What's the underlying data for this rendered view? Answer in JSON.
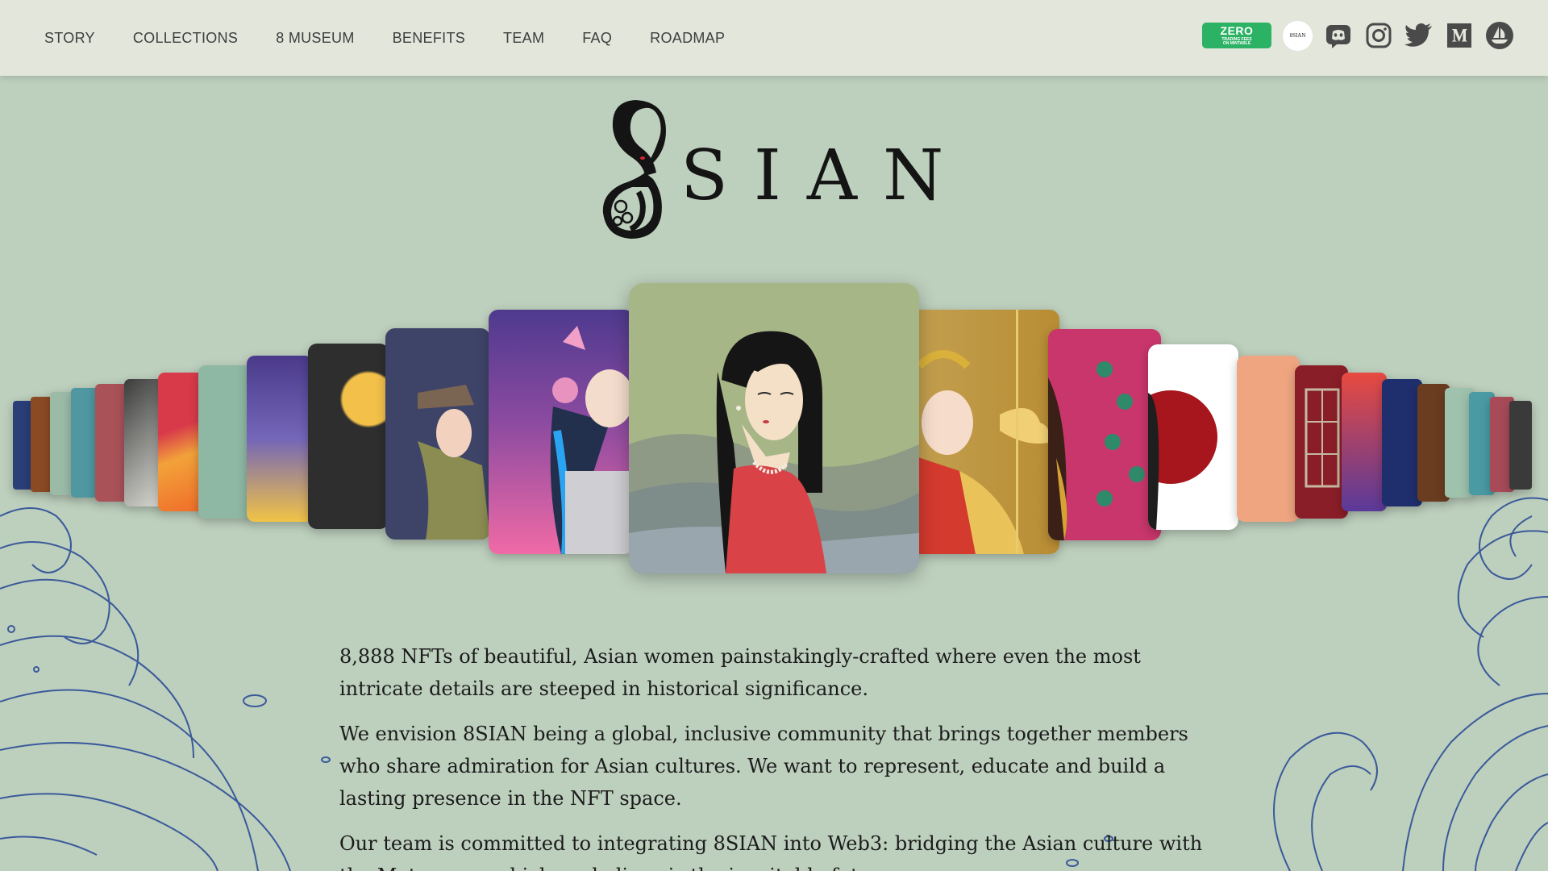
{
  "nav": {
    "links": [
      "STORY",
      "COLLECTIONS",
      "8 MUSEUM",
      "BENEFITS",
      "TEAM",
      "FAQ",
      "ROADMAP"
    ],
    "badge": {
      "title": "ZERO",
      "line1": "TRADING FEES",
      "line2": "ON MINTABLE"
    },
    "circle_logo_text": "8SIAN",
    "icons": [
      "zero-fees-badge",
      "8sian-circle-logo",
      "discord-icon",
      "instagram-icon",
      "twitter-icon",
      "medium-icon",
      "opensea-icon"
    ]
  },
  "logo": {
    "word": "SIAN"
  },
  "about": {
    "paragraphs": [
      "8,888 NFTs of beautiful, Asian women painstakingly-crafted where even the most intricate details are steeped in historical significance.",
      "We envision 8SIAN being a global, inclusive community that brings together members who share admiration for Asian cultures. We want to represent, educate and build a lasting presence in the NFT space.",
      "Our team is committed to integrating 8SIAN into Web3: bridging the Asian culture with the Metaverse, which we believe is the inevitable future."
    ]
  },
  "colors": {
    "background": "#bdcfbd",
    "nav_background": "#e3e6da",
    "badge_green": "#2cb264",
    "wave_line": "#3a5a9a",
    "center_card_bg": "#a7b687",
    "center_dress": "#d94348"
  }
}
